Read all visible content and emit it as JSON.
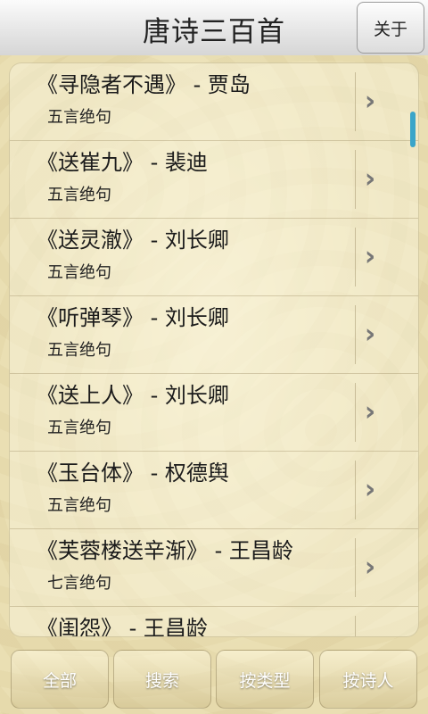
{
  "header": {
    "title": "唐诗三百首",
    "about_label": "关于"
  },
  "poems": [
    {
      "name": "《寻隐者不遇》 - 贾岛",
      "type": "五言绝句"
    },
    {
      "name": "《送崔九》 - 裴迪",
      "type": "五言绝句"
    },
    {
      "name": "《送灵澈》 - 刘长卿",
      "type": "五言绝句"
    },
    {
      "name": "《听弹琴》 - 刘长卿",
      "type": "五言绝句"
    },
    {
      "name": "《送上人》 - 刘长卿",
      "type": "五言绝句"
    },
    {
      "name": "《玉台体》 - 权德舆",
      "type": "五言绝句"
    },
    {
      "name": "《芙蓉楼送辛渐》 - 王昌龄",
      "type": "七言绝句"
    },
    {
      "name": "《闺怨》 - 王昌龄",
      "type": ""
    }
  ],
  "icons": {
    "row_action": "chevron-right-icon"
  },
  "tabs": [
    {
      "label": "全部"
    },
    {
      "label": "搜索"
    },
    {
      "label": "按类型"
    },
    {
      "label": "按诗人"
    }
  ],
  "colors": {
    "scroll_indicator": "#3aa5c9"
  }
}
